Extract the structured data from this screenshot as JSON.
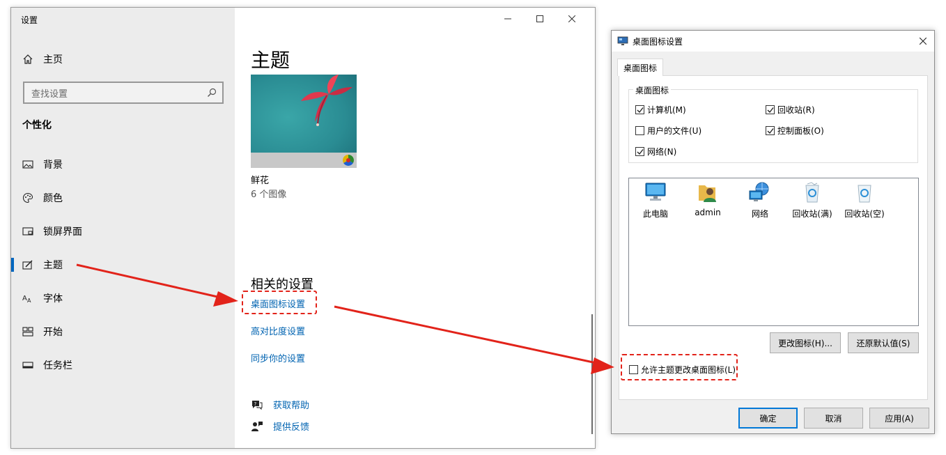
{
  "settings": {
    "window_title": "设置",
    "home": "主页",
    "search_placeholder": "查找设置",
    "section": "个性化",
    "nav": [
      {
        "label": "背景",
        "icon": "picture-icon"
      },
      {
        "label": "颜色",
        "icon": "palette-icon"
      },
      {
        "label": "锁屏界面",
        "icon": "lock-screen-icon"
      },
      {
        "label": "主题",
        "icon": "theme-brush-icon",
        "active": true
      },
      {
        "label": "字体",
        "icon": "font-icon"
      },
      {
        "label": "开始",
        "icon": "start-icon"
      },
      {
        "label": "任务栏",
        "icon": "taskbar-icon"
      }
    ],
    "page_title": "主题",
    "theme_name": "鲜花",
    "theme_count": "6 个图像",
    "related_title": "相关的设置",
    "links": [
      "桌面图标设置",
      "高对比度设置",
      "同步你的设置"
    ],
    "help": "获取帮助",
    "feedback": "提供反馈",
    "accent_color": "#0063b1"
  },
  "dialog": {
    "title": "桌面图标设置",
    "tab": "桌面图标",
    "group_label": "桌面图标",
    "checkboxes": [
      {
        "label": "计算机(M)",
        "checked": true
      },
      {
        "label": "回收站(R)",
        "checked": true
      },
      {
        "label": "用户的文件(U)",
        "checked": false
      },
      {
        "label": "控制面板(O)",
        "checked": true
      },
      {
        "label": "网络(N)",
        "checked": true
      }
    ],
    "icons": [
      {
        "label": "此电脑",
        "icon": "this-pc-icon"
      },
      {
        "label": "admin",
        "icon": "user-folder-icon"
      },
      {
        "label": "网络",
        "icon": "network-icon"
      },
      {
        "label": "回收站(满)",
        "icon": "recycle-bin-full-icon"
      },
      {
        "label": "回收站(空)",
        "icon": "recycle-bin-empty-icon"
      }
    ],
    "change_icon": "更改图标(H)...",
    "restore_default": "还原默认值(S)",
    "allow_themes": {
      "label": "允许主题更改桌面图标(L)",
      "checked": false
    },
    "ok": "确定",
    "cancel": "取消",
    "apply": "应用(A)"
  },
  "annotation_color": "#e2231a"
}
